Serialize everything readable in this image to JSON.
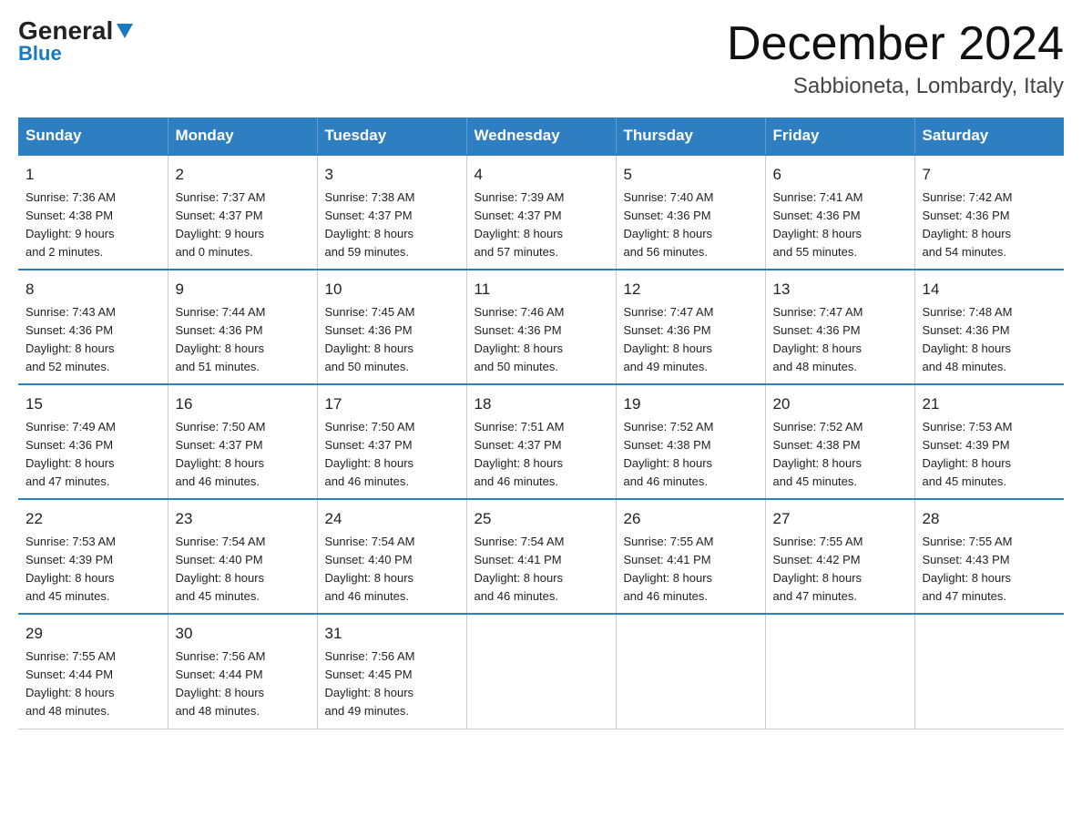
{
  "header": {
    "logo_general": "General",
    "logo_blue": "Blue",
    "month_title": "December 2024",
    "location": "Sabbioneta, Lombardy, Italy"
  },
  "days_of_week": [
    "Sunday",
    "Monday",
    "Tuesday",
    "Wednesday",
    "Thursday",
    "Friday",
    "Saturday"
  ],
  "weeks": [
    [
      {
        "day": "1",
        "sunrise": "7:36 AM",
        "sunset": "4:38 PM",
        "daylight": "9 hours and 2 minutes."
      },
      {
        "day": "2",
        "sunrise": "7:37 AM",
        "sunset": "4:37 PM",
        "daylight": "9 hours and 0 minutes."
      },
      {
        "day": "3",
        "sunrise": "7:38 AM",
        "sunset": "4:37 PM",
        "daylight": "8 hours and 59 minutes."
      },
      {
        "day": "4",
        "sunrise": "7:39 AM",
        "sunset": "4:37 PM",
        "daylight": "8 hours and 57 minutes."
      },
      {
        "day": "5",
        "sunrise": "7:40 AM",
        "sunset": "4:36 PM",
        "daylight": "8 hours and 56 minutes."
      },
      {
        "day": "6",
        "sunrise": "7:41 AM",
        "sunset": "4:36 PM",
        "daylight": "8 hours and 55 minutes."
      },
      {
        "day": "7",
        "sunrise": "7:42 AM",
        "sunset": "4:36 PM",
        "daylight": "8 hours and 54 minutes."
      }
    ],
    [
      {
        "day": "8",
        "sunrise": "7:43 AM",
        "sunset": "4:36 PM",
        "daylight": "8 hours and 52 minutes."
      },
      {
        "day": "9",
        "sunrise": "7:44 AM",
        "sunset": "4:36 PM",
        "daylight": "8 hours and 51 minutes."
      },
      {
        "day": "10",
        "sunrise": "7:45 AM",
        "sunset": "4:36 PM",
        "daylight": "8 hours and 50 minutes."
      },
      {
        "day": "11",
        "sunrise": "7:46 AM",
        "sunset": "4:36 PM",
        "daylight": "8 hours and 50 minutes."
      },
      {
        "day": "12",
        "sunrise": "7:47 AM",
        "sunset": "4:36 PM",
        "daylight": "8 hours and 49 minutes."
      },
      {
        "day": "13",
        "sunrise": "7:47 AM",
        "sunset": "4:36 PM",
        "daylight": "8 hours and 48 minutes."
      },
      {
        "day": "14",
        "sunrise": "7:48 AM",
        "sunset": "4:36 PM",
        "daylight": "8 hours and 48 minutes."
      }
    ],
    [
      {
        "day": "15",
        "sunrise": "7:49 AM",
        "sunset": "4:36 PM",
        "daylight": "8 hours and 47 minutes."
      },
      {
        "day": "16",
        "sunrise": "7:50 AM",
        "sunset": "4:37 PM",
        "daylight": "8 hours and 46 minutes."
      },
      {
        "day": "17",
        "sunrise": "7:50 AM",
        "sunset": "4:37 PM",
        "daylight": "8 hours and 46 minutes."
      },
      {
        "day": "18",
        "sunrise": "7:51 AM",
        "sunset": "4:37 PM",
        "daylight": "8 hours and 46 minutes."
      },
      {
        "day": "19",
        "sunrise": "7:52 AM",
        "sunset": "4:38 PM",
        "daylight": "8 hours and 46 minutes."
      },
      {
        "day": "20",
        "sunrise": "7:52 AM",
        "sunset": "4:38 PM",
        "daylight": "8 hours and 45 minutes."
      },
      {
        "day": "21",
        "sunrise": "7:53 AM",
        "sunset": "4:39 PM",
        "daylight": "8 hours and 45 minutes."
      }
    ],
    [
      {
        "day": "22",
        "sunrise": "7:53 AM",
        "sunset": "4:39 PM",
        "daylight": "8 hours and 45 minutes."
      },
      {
        "day": "23",
        "sunrise": "7:54 AM",
        "sunset": "4:40 PM",
        "daylight": "8 hours and 45 minutes."
      },
      {
        "day": "24",
        "sunrise": "7:54 AM",
        "sunset": "4:40 PM",
        "daylight": "8 hours and 46 minutes."
      },
      {
        "day": "25",
        "sunrise": "7:54 AM",
        "sunset": "4:41 PM",
        "daylight": "8 hours and 46 minutes."
      },
      {
        "day": "26",
        "sunrise": "7:55 AM",
        "sunset": "4:41 PM",
        "daylight": "8 hours and 46 minutes."
      },
      {
        "day": "27",
        "sunrise": "7:55 AM",
        "sunset": "4:42 PM",
        "daylight": "8 hours and 47 minutes."
      },
      {
        "day": "28",
        "sunrise": "7:55 AM",
        "sunset": "4:43 PM",
        "daylight": "8 hours and 47 minutes."
      }
    ],
    [
      {
        "day": "29",
        "sunrise": "7:55 AM",
        "sunset": "4:44 PM",
        "daylight": "8 hours and 48 minutes."
      },
      {
        "day": "30",
        "sunrise": "7:56 AM",
        "sunset": "4:44 PM",
        "daylight": "8 hours and 48 minutes."
      },
      {
        "day": "31",
        "sunrise": "7:56 AM",
        "sunset": "4:45 PM",
        "daylight": "8 hours and 49 minutes."
      },
      null,
      null,
      null,
      null
    ]
  ],
  "labels": {
    "sunrise": "Sunrise:",
    "sunset": "Sunset:",
    "daylight": "Daylight:"
  }
}
